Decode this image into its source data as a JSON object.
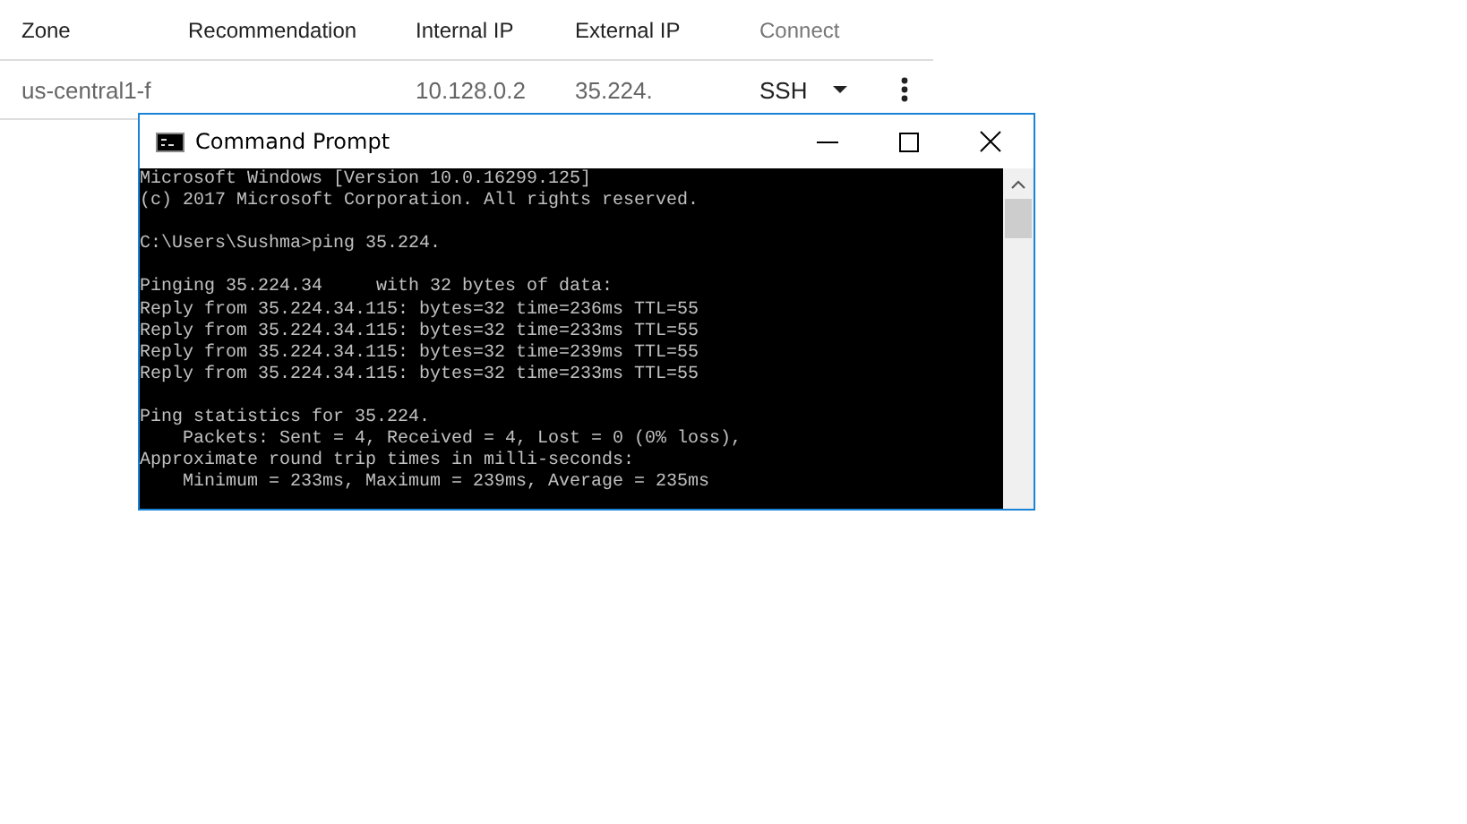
{
  "table": {
    "columns": [
      "Zone",
      "Recommendation",
      "Internal IP",
      "External IP",
      "Connect"
    ],
    "rows": [
      {
        "zone": "us-central1-f",
        "internal_ip": "10.128.0.2",
        "external_ip": "35.224.",
        "connect": "SSH"
      }
    ]
  },
  "window": {
    "title": "Command Prompt",
    "blocks": [
      [
        "Microsoft Windows [Version 10.0.16299.125]",
        "(c) 2017 Microsoft Corporation. All rights reserved."
      ],
      [
        "C:\\Users\\Sushma>ping 35.224."
      ],
      [
        "Pinging 35.224.34     with 32 bytes of data:",
        "Reply from 35.224.34.115: bytes=32 time=236ms TTL=55",
        "Reply from 35.224.34.115: bytes=32 time=233ms TTL=55",
        "Reply from 35.224.34.115: bytes=32 time=239ms TTL=55",
        "Reply from 35.224.34.115: bytes=32 time=233ms TTL=55"
      ],
      [
        "Ping statistics for 35.224.",
        "    Packets: Sent = 4, Received = 4, Lost = 0 (0% loss),",
        "Approximate round trip times in milli-seconds:",
        "    Minimum = 233ms, Maximum = 239ms, Average = 235ms"
      ]
    ]
  }
}
